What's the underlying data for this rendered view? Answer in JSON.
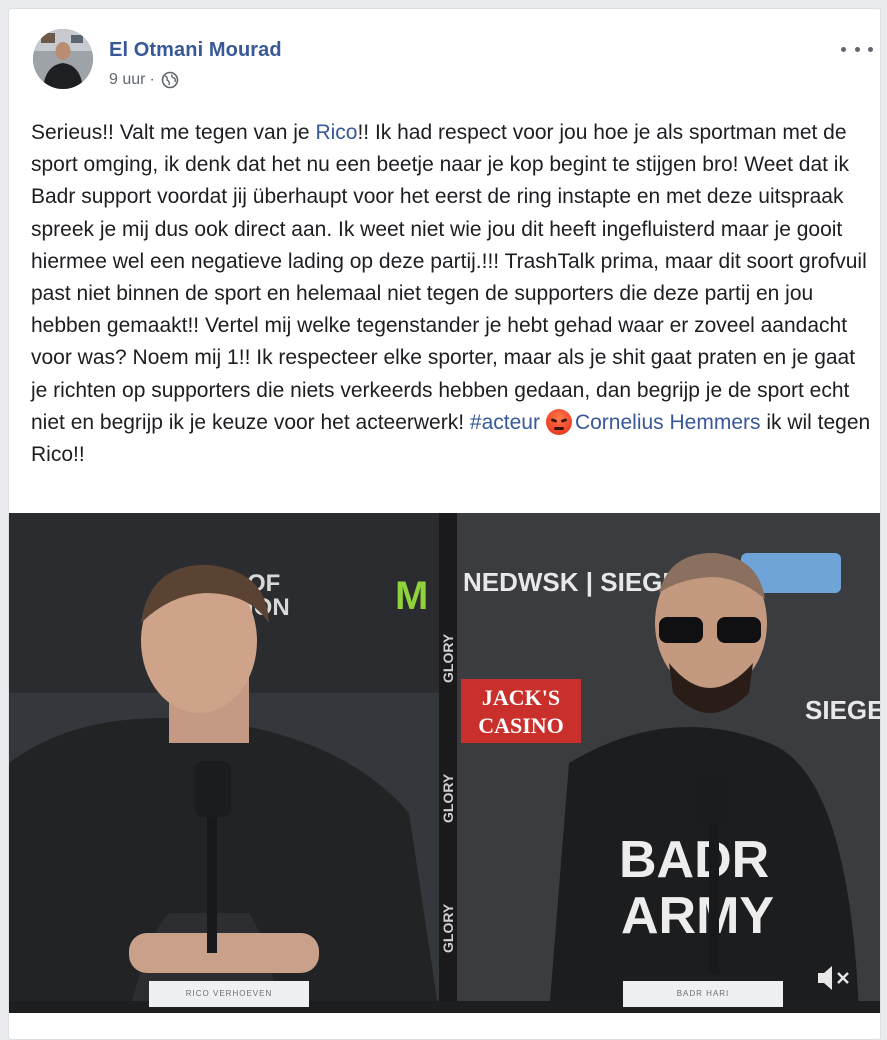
{
  "post": {
    "author": "El Otmani Mourad",
    "time": "9 uur",
    "separator": "·",
    "privacy_icon": "globe-icon",
    "body": {
      "t1": "Serieus!! Valt me tegen van je ",
      "mention_rico": "Rico",
      "t2": "!! Ik had respect voor jou hoe je als sportman met de sport omging, ik denk dat het nu een beetje naar je kop begint te stijgen bro! Weet dat ik Badr support voordat jij überhaupt voor het eerst de ring instapte en met deze uitspraak spreek je mij dus ook direct aan. Ik weet niet wie jou dit heeft ingefluisterd maar je gooit hiermee wel een negatieve lading op deze partij.!!! TrashTalk prima, maar dit soort grofvuil past niet binnen de sport en helemaal niet tegen de supporters die deze partij en jou hebben gemaakt!! Vertel mij welke tegenstander je hebt gehad waar er zoveel aandacht voor was? Noem mij 1!! Ik respecteer elke sporter, maar als je shit gaat praten en je gaat je richten op supporters die niets verkeerds hebben gedaan, dan begrijp je de sport echt niet en begrijp ik je keuze voor het acteerwerk! ",
      "hashtag": "#acteur",
      "emoji": "angry-face-emoji",
      "mention_cornelius": "Cornelius Hemmers",
      "t3": " ik wil tegen Rico!!"
    }
  },
  "video": {
    "left_sign": "OF\nION",
    "sponsor_top": "NEDWSK | SIEGE",
    "brand_vertical": "GLORY",
    "jacks_casino": "JACK'S\nCASINO",
    "siege": "SIEGE",
    "shirt": "BADR\nARMY",
    "nameplate_left": "RICO VERHOEVEN",
    "nameplate_right": "BADR HARI",
    "mute_icon": "speaker-muted-icon"
  },
  "colors": {
    "link": "#385898",
    "text": "#1c1e21",
    "meta": "#606770",
    "background": "#e9ebee"
  }
}
